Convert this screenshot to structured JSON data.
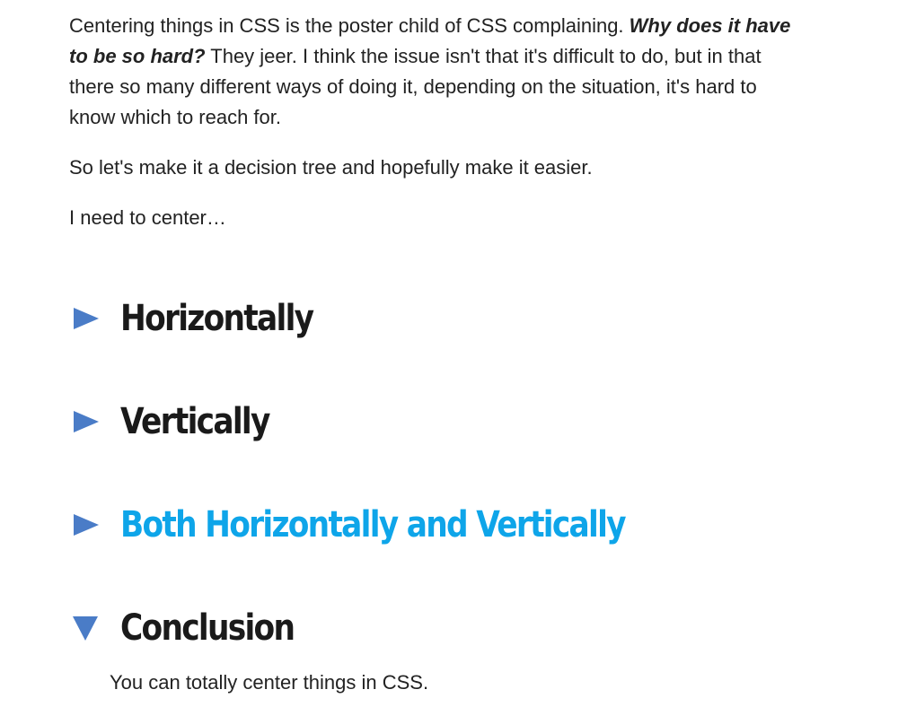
{
  "intro": {
    "line1_prefix": "Centering things in CSS is the poster child of CSS complaining. ",
    "line1_emphasis": "Why does it have to be so hard?",
    "line1_suffix": " They jeer. I think the issue isn't that it's difficult to do, but in that there so many different ways of doing it, depending on the situation, it's hard to know which to reach for.",
    "line2": "So let's make it a decision tree and hopefully make it easier.",
    "line3": "I need to center…"
  },
  "sections": [
    {
      "label": "Horizontally",
      "state": "collapsed",
      "icon": "triangle-right-icon"
    },
    {
      "label": "Vertically",
      "state": "collapsed",
      "icon": "triangle-right-icon"
    },
    {
      "label": "Both Horizontally and Vertically",
      "state": "collapsed",
      "icon": "triangle-right-icon",
      "highlighted": true
    },
    {
      "label": "Conclusion",
      "state": "expanded",
      "icon": "triangle-down-icon",
      "body": "You can totally center things in CSS."
    }
  ],
  "colors": {
    "marker": "#4a7cc7",
    "link_highlight": "#0ea5e9",
    "text": "#222222",
    "heading": "#1a1a1a"
  }
}
